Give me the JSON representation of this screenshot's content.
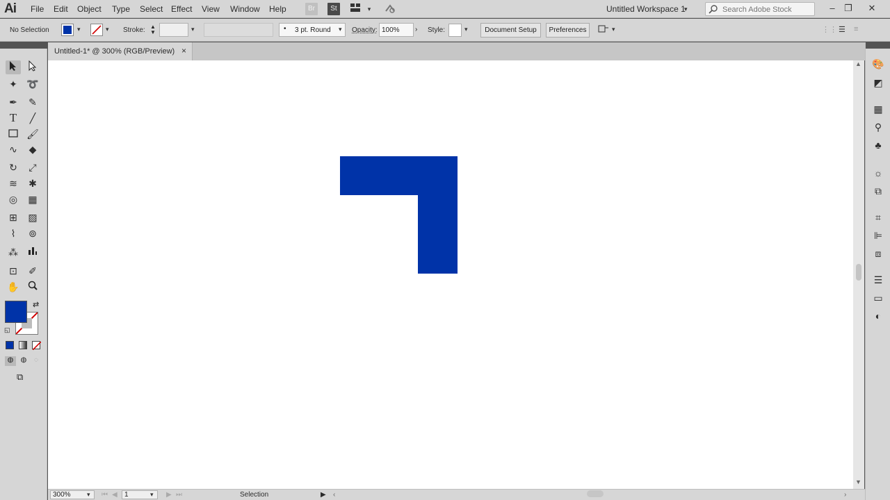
{
  "app": {
    "logo": "Ai"
  },
  "menu": [
    "File",
    "Edit",
    "Object",
    "Type",
    "Select",
    "Effect",
    "View",
    "Window",
    "Help"
  ],
  "menubar_icons": {
    "bridge": "Br",
    "stock": "St"
  },
  "workspace": {
    "label": "Untitled Workspace 1"
  },
  "search": {
    "placeholder": "Search Adobe Stock"
  },
  "control": {
    "selection": "No Selection",
    "stroke_label": "Stroke:",
    "brush": "3 pt. Round",
    "opacity_label": "Opacity:",
    "opacity_value": "100%",
    "style_label": "Style:",
    "document_setup": "Document Setup",
    "preferences": "Preferences"
  },
  "document": {
    "tab_title": "Untitled-1* @ 300% (RGB/Preview)"
  },
  "colors": {
    "fill": "#0033a8",
    "ui_bg": "#d6d6d6",
    "canvas": "#ffffff"
  },
  "status": {
    "zoom": "300%",
    "artboard": "1",
    "tool": "Selection"
  }
}
